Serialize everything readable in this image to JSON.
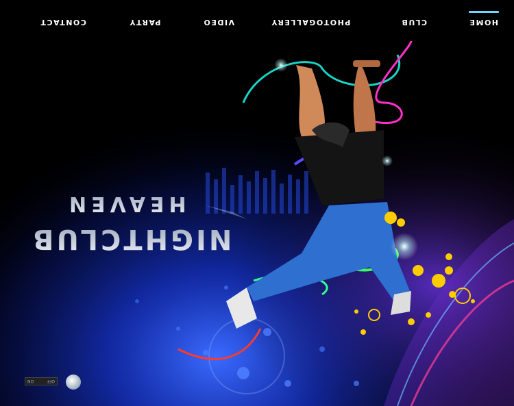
{
  "nav": {
    "items": [
      {
        "label": "HOME",
        "active": true
      },
      {
        "label": "CLUB"
      },
      {
        "label": "PHOTOGALLERY"
      },
      {
        "label": "VIDEO"
      },
      {
        "label": "PARTY"
      },
      {
        "label": "CONTACT"
      }
    ]
  },
  "hero": {
    "title_line1": "NIGHTCLUB",
    "title_line2": "HEAVEN"
  },
  "sound": {
    "off_label": "OFF",
    "on_label": "ON"
  },
  "colors": {
    "accent": "#6fd7ff",
    "background": "#000000",
    "glow_blue": "#1a3cff"
  },
  "icons": [
    "speaker-icon"
  ]
}
